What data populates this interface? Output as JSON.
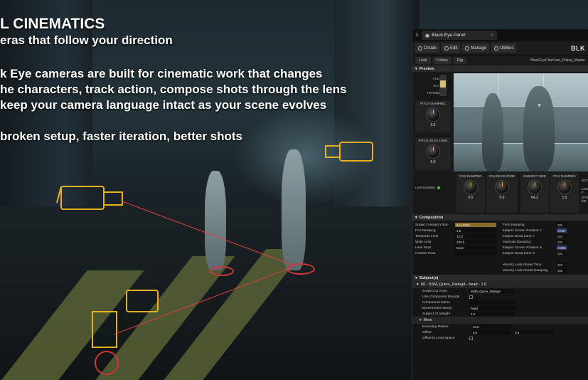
{
  "overlay": {
    "headline": "L CINEMATICS",
    "subhead": "eras that follow your direction",
    "paragraph_lines": [
      "k Eye cameras are built for cinematic work that changes",
      "he characters, track action, compose shots through the lens",
      "keep your camera language intact as your scene evolves"
    ],
    "tagline": "broken setup, faster iteration, better shots"
  },
  "panel": {
    "tab_title": "Black Eye Panel",
    "tab_close": "×",
    "toolbar": {
      "create": "Create",
      "edit": "Edit",
      "manage": "Manage",
      "utilities": "Utilities",
      "brand": "BLK"
    },
    "modes": [
      "Look",
      "Follow",
      "Rig"
    ],
    "camera_name": "BlackEyeCineCam_Dialog_Master",
    "preview": {
      "header": "Preview",
      "framing_labels": [
        "FULL",
        "FLAT",
        "FRAMED"
      ],
      "pitch_damping": {
        "label": "PITCH DAMPING",
        "value": "0.5"
      },
      "pitch_dead_zone": {
        "label": "PITCH DEAD ZONE",
        "value": "0.0"
      },
      "locked_label": "Look Enabled",
      "bottom_knobs": [
        {
          "label": "PAN DAMPING",
          "value": "0.5"
        },
        {
          "label": "PAN DEAD ZONE",
          "value": "0.0"
        },
        {
          "label": "SUBJECT SIZE",
          "value": "64.2"
        },
        {
          "label": "FOV DAMPING",
          "value": "1.5"
        }
      ],
      "side_labels": [
        "SCF",
        "LENS F",
        "DYN ZO"
      ]
    },
    "composition": {
      "header": "Composition",
      "left_rows": [
        {
          "label": "Subject Viewport Size",
          "value": "64.19802",
          "style": "hl"
        },
        {
          "label": "Fov Damping",
          "value": "1.5",
          "style": ""
        },
        {
          "label": "Telephoto Limit",
          "value": "72.0",
          "style": ""
        },
        {
          "label": "Wide Limit",
          "value": "130.0",
          "style": ""
        },
        {
          "label": "Lens Pack",
          "value": "None",
          "style": ""
        },
        {
          "label": "Custom Pack",
          "value": "",
          "style": ""
        }
      ],
      "right_rows": [
        {
          "label": "Pitch Damping",
          "value": "0.5",
          "style": ""
        },
        {
          "label": "Subject Screen Position Y",
          "value": "0.547",
          "style": "hl2"
        },
        {
          "label": "Subject Dead Zone Y",
          "value": "0.0",
          "style": ""
        },
        {
          "label": "Yaw/Link Damping",
          "value": "0.5",
          "style": ""
        },
        {
          "label": "Subject Screen Position X",
          "value": "0.502",
          "style": "hl2"
        },
        {
          "label": "Subject Dead Zone X",
          "value": "0.0",
          "style": ""
        },
        {
          "label": "",
          "value": "",
          "style": ""
        },
        {
          "label": "Velocity Look Ahead Time",
          "value": "0.0",
          "style": ""
        },
        {
          "label": "Velocity Look Ahead Damping",
          "value": "0.5",
          "style": ""
        }
      ]
    },
    "subjects": {
      "header": "Subject(s)",
      "subject_title": "00 - SSM_Quinn_DialogA - head - 1.0",
      "rows": [
        {
          "label": "Subject 01 Actor",
          "value": "SSM_Quinn_DialogA"
        },
        {
          "label": "Use Component Bounds",
          "value": ""
        },
        {
          "label": "Component Name",
          "value": ""
        },
        {
          "label": "Bone/Socket Name",
          "value": "head"
        },
        {
          "label": "Subject 01 Weight",
          "value": "1.0"
        }
      ],
      "more": {
        "header": "More",
        "rows": [
          {
            "label": "Bounding Radius",
            "value": "10.0",
            "value2": ""
          },
          {
            "label": "Offset",
            "value": "0.0",
            "value2": "0.0"
          },
          {
            "label": "Offset in Local Space",
            "value": "",
            "value2": ""
          }
        ]
      }
    }
  }
}
